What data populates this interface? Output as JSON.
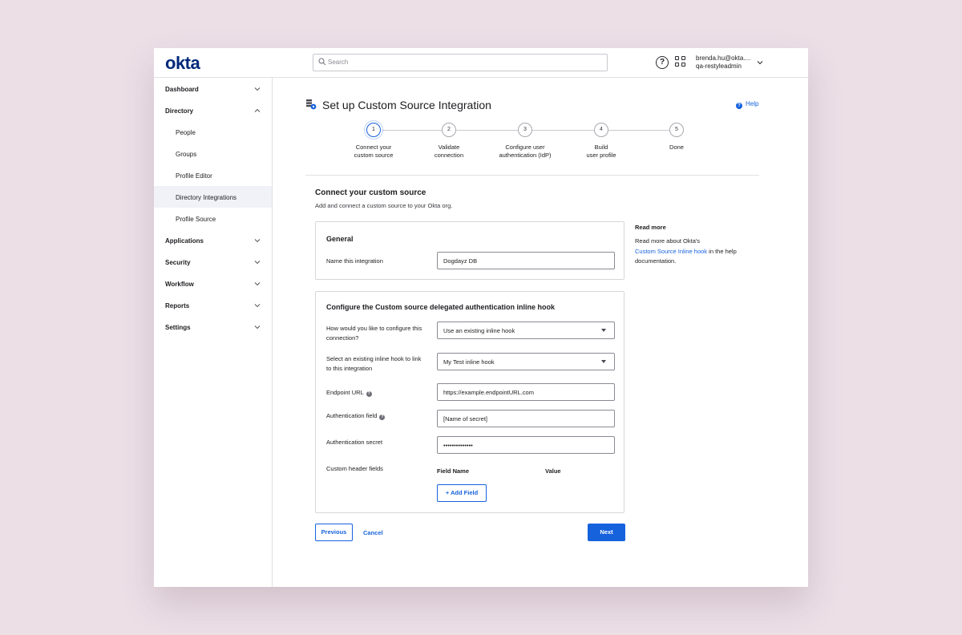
{
  "header": {
    "logo": "okta",
    "search_placeholder": "Search",
    "help_icon": "help-circle-icon",
    "user_email": "brenda.hu@okta....",
    "user_org": "qa-restyleadmin"
  },
  "sidebar": {
    "items": [
      {
        "label": "Dashboard",
        "expanded": false
      },
      {
        "label": "Directory",
        "expanded": true
      },
      {
        "label": "People"
      },
      {
        "label": "Groups"
      },
      {
        "label": "Profile Editor"
      },
      {
        "label": "Directory Integrations",
        "active": true
      },
      {
        "label": "Profile Source"
      },
      {
        "label": "Applications",
        "expanded": false
      },
      {
        "label": "Security",
        "expanded": false
      },
      {
        "label": "Workflow",
        "expanded": false
      },
      {
        "label": "Reports",
        "expanded": false
      },
      {
        "label": "Settings",
        "expanded": false
      }
    ]
  },
  "page": {
    "title": "Set up Custom Source Integration",
    "help_label": "Help"
  },
  "stepper": {
    "current": 1,
    "steps": [
      {
        "number": "1",
        "line1": "Connect your",
        "line2": "custom source"
      },
      {
        "number": "2",
        "line1": "Validate",
        "line2": "connection"
      },
      {
        "number": "3",
        "line1": "Configure user",
        "line2": "authentication (IdP)"
      },
      {
        "number": "4",
        "line1": "Build",
        "line2": "user profile"
      },
      {
        "number": "5",
        "line1": "Done",
        "line2": ""
      }
    ]
  },
  "section": {
    "title": "Connect your custom source",
    "subtitle": "Add and connect a custom source to your Okta org."
  },
  "general": {
    "title": "General",
    "name_label": "Name this integration",
    "name_value": "Dogdayz DB"
  },
  "hook": {
    "title": "Configure the Custom source delegated authentication inline hook",
    "configure_label": "How would you like to configure this connection?",
    "configure_value": "Use an existing inline hook",
    "existing_label": "Select an existing inline hook to link to this integration",
    "existing_value": "My Test inline hook",
    "endpoint_label": "Endpoint URL",
    "endpoint_value": "https://example.endpointURL.com",
    "auth_field_label": "Authentication field",
    "auth_field_value": "[Name of secret]",
    "auth_secret_label": "Authentication secret",
    "auth_secret_value": "••••••••••••••",
    "custom_header_label": "Custom header fields",
    "field_name_header": "Field Name",
    "value_header": "Value",
    "add_field_label": "+ Add Field"
  },
  "read_more": {
    "title": "Read more",
    "text_before": "Read more about Okta's",
    "link": "Custom Source Inline hook",
    "text_after": "in the help documentation."
  },
  "footer": {
    "previous_label": "Previous",
    "cancel_label": "Cancel",
    "next_label": "Next"
  },
  "colors": {
    "accent": "#1662dd",
    "logo": "#00297a",
    "background": "#ecdfe6"
  }
}
